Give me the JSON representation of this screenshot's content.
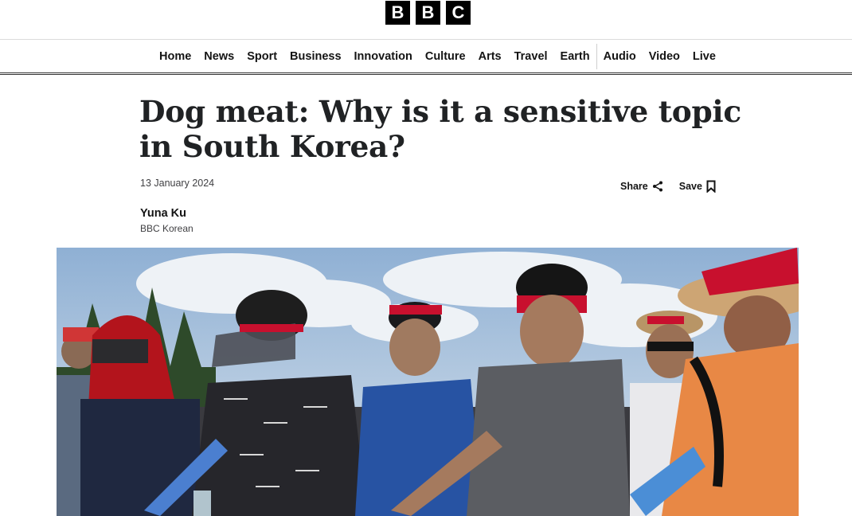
{
  "masthead": {
    "logo_letters": [
      "B",
      "B",
      "C"
    ]
  },
  "nav": {
    "items": [
      {
        "label": "Home"
      },
      {
        "label": "News"
      },
      {
        "label": "Sport"
      },
      {
        "label": "Business"
      },
      {
        "label": "Innovation"
      },
      {
        "label": "Culture"
      },
      {
        "label": "Arts"
      },
      {
        "label": "Travel"
      },
      {
        "label": "Earth"
      },
      {
        "label": "Audio"
      },
      {
        "label": "Video"
      },
      {
        "label": "Live"
      }
    ]
  },
  "article": {
    "headline": "Dog meat: Why is it a sensitive topic in South Korea?",
    "date": "13 January 2024",
    "share_label": "Share",
    "save_label": "Save",
    "author_name": "Yuna Ku",
    "author_org": "BBC Korean"
  },
  "colors": {
    "logo_bg": "#000000",
    "text": "#141414",
    "headband_red": "#c8102e",
    "sky": "#b7cbe0"
  }
}
